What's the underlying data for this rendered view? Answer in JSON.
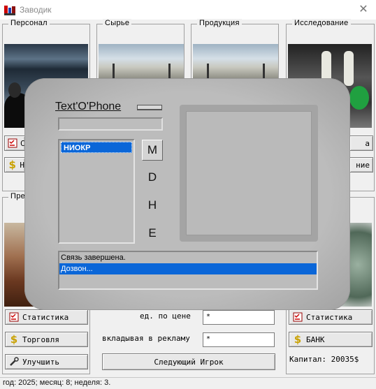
{
  "window": {
    "title": "Заводик",
    "close_symbol": "✕"
  },
  "groups": {
    "personnel": "Персонал",
    "raw": "Сырье",
    "products": "Продукция",
    "research": "Исследование",
    "enterprise": "Пре"
  },
  "buttons": {
    "personnel_stats": "С",
    "personnel_trade": "Н",
    "research_stats": "а",
    "research_trade": "ние",
    "stats": "Статистика",
    "trade": "Торговля",
    "upgrade": "Улучшить",
    "next_player": "Следующий Игрок",
    "stats_right": "Статистика",
    "bank": "БАНК"
  },
  "market": {
    "price_label": "ед. по цене",
    "price_value": "*",
    "ad_label": "вкладывая в рекламу",
    "ad_value": "*"
  },
  "capital": "Капитал: 20035$",
  "status": "год: 2025; месяц: 8; неделя: 3.",
  "phone": {
    "title": "Text'O'Phone",
    "input_value": "",
    "list": [
      "НИОКР"
    ],
    "modes": [
      "M",
      "D",
      "H",
      "E"
    ],
    "active_mode": "M",
    "log": [
      "Связь завершена.",
      "Дозвон..."
    ],
    "log_selected": 1
  },
  "icons": {
    "app": "factory-app-icon",
    "stats": "checklist-icon",
    "trade": "dollar-icon",
    "upgrade": "wrench-icon"
  },
  "colors": {
    "selection": "#0a66d8",
    "dollar": "#c9a100",
    "phone_body": "#bcbcbc"
  }
}
